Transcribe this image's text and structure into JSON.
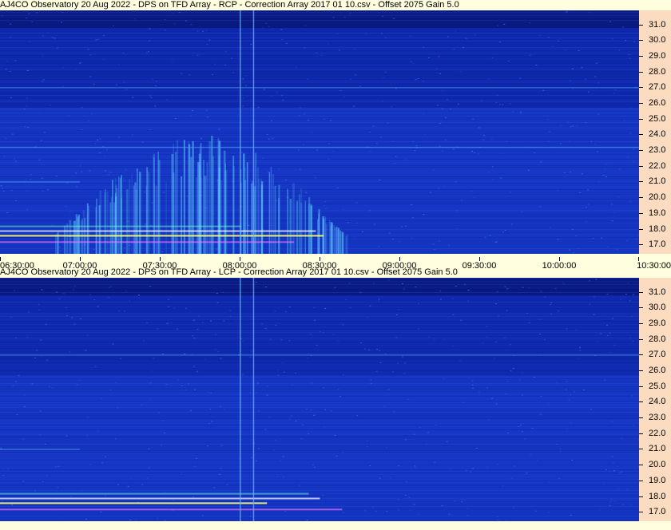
{
  "panels": [
    {
      "title": "AJ4CO Observatory 20 Aug 2022  -  DPS on TFD Array  -  RCP  -  Correction Array 2017 01 10.csv  -  Offset 2075  Gain 5.0",
      "polarization": "RCP"
    },
    {
      "title": "AJ4CO Observatory 20 Aug 2022  -  DPS on TFD Array  -  LCP  -  Correction Array 2017 01 10.csv  -  Offset 2075  Gain 5.0",
      "polarization": "LCP"
    }
  ],
  "chart_data": [
    {
      "type": "heatmap",
      "title": "AJ4CO Observatory 20 Aug 2022  -  DPS on TFD Array  -  RCP  -  Correction Array 2017 01 10.csv  -  Offset 2075  Gain 5.0",
      "x_ticks": [
        "06:30:00",
        "07:00:00",
        "07:30:00",
        "08:00:00",
        "08:30:00",
        "09:00:00",
        "09:30:00",
        "10:00:00",
        "10:30:00"
      ],
      "y_ticks": [
        "31.0",
        "30.0",
        "29.0",
        "28.0",
        "27.0",
        "26.0",
        "25.0",
        "24.0",
        "23.0",
        "22.0",
        "21.0",
        "20.0",
        "19.0",
        "18.0",
        "17.0"
      ],
      "xlim": [
        "06:30:00",
        "10:30:00"
      ],
      "ylim": [
        16.4,
        31.9
      ],
      "colors": {
        "background": "#1536c4",
        "burst": "#5fc8ff",
        "interference": "#ffff66"
      },
      "features": {
        "burst": {
          "start": "06:50:00",
          "end": "08:40:00",
          "freq_max": 24.0
        },
        "vertical_lines": [
          "08:00:00",
          "08:05:00"
        ],
        "horizontal_lines": [
          27.0,
          23.2
        ]
      }
    },
    {
      "type": "heatmap",
      "title": "AJ4CO Observatory 20 Aug 2022  -  DPS on TFD Array  -  LCP  -  Correction Array 2017 01 10.csv  -  Offset 2075  Gain 5.0",
      "y_ticks": [
        "31.0",
        "30.0",
        "29.0",
        "28.0",
        "27.0",
        "26.0",
        "25.0",
        "24.0",
        "23.0",
        "22.0",
        "21.0",
        "20.0",
        "19.0",
        "18.0",
        "17.0"
      ],
      "ylim": [
        16.4,
        31.9
      ],
      "colors": {
        "background": "#1536c4",
        "interference": "#ffff66"
      },
      "features": {
        "vertical_lines": [
          "08:00:00",
          "08:05:00"
        ],
        "horizontal_lines": [
          27.0
        ]
      }
    }
  ]
}
